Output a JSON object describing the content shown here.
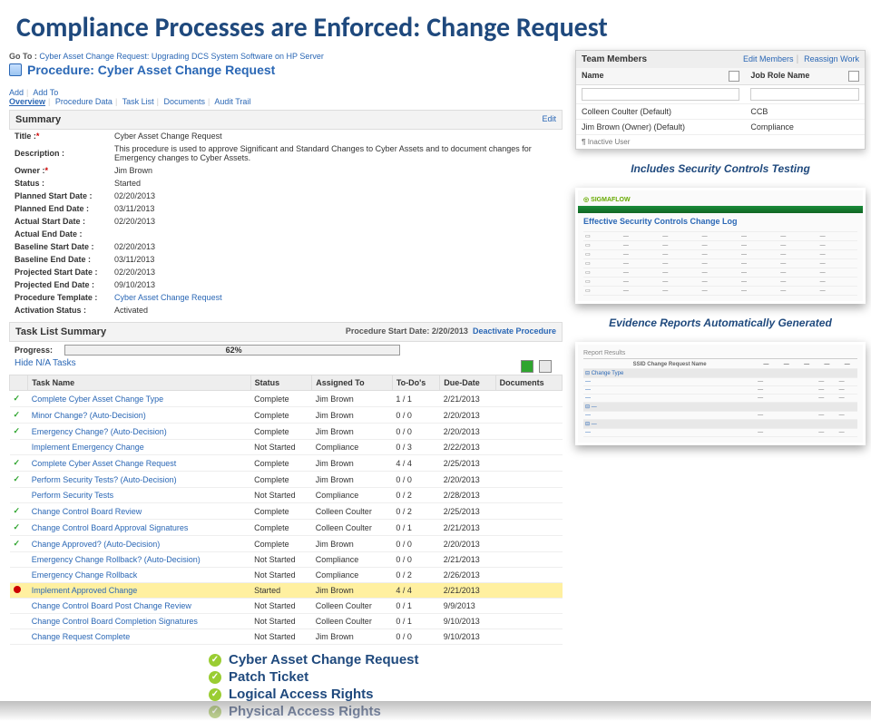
{
  "slide_title": "Compliance Processes are Enforced: Change Request",
  "goto": {
    "label": "Go To :",
    "link": "Cyber Asset Change Request: Upgrading DCS System Software on HP Server"
  },
  "procedure_title": "Procedure: Cyber Asset Change Request",
  "tabs": {
    "add": "Add",
    "add_to": "Add To",
    "overview": "Overview",
    "procedure_data": "Procedure Data",
    "task_list": "Task List",
    "documents": "Documents",
    "audit_trail": "Audit Trail"
  },
  "summary_header": "Summary",
  "edit_link": "Edit",
  "summary": [
    {
      "k": "Title :",
      "req": true,
      "v": "Cyber Asset Change Request"
    },
    {
      "k": "Description :",
      "v": "This procedure is used to approve Significant and Standard Changes to Cyber Assets and to document changes for Emergency changes to Cyber Assets."
    },
    {
      "k": "Owner :",
      "req": true,
      "v": "Jim Brown"
    },
    {
      "k": "Status :",
      "v": "Started"
    },
    {
      "k": "Planned Start Date :",
      "v": "02/20/2013"
    },
    {
      "k": "Planned End Date :",
      "v": "03/11/2013"
    },
    {
      "k": "Actual Start Date :",
      "v": "02/20/2013"
    },
    {
      "k": "Actual End Date :",
      "v": ""
    },
    {
      "k": "Baseline Start Date :",
      "v": "02/20/2013"
    },
    {
      "k": "Baseline End Date :",
      "v": "03/11/2013"
    },
    {
      "k": "Projected Start Date :",
      "v": "02/20/2013"
    },
    {
      "k": "Projected End Date :",
      "v": "09/10/2013"
    },
    {
      "k": "Procedure Template :",
      "v": "Cyber Asset Change Request",
      "link": true
    },
    {
      "k": "Activation Status :",
      "v": "Activated"
    }
  ],
  "task_list_header": "Task List Summary",
  "proc_start": {
    "label": "Procedure Start Date:",
    "value": "2/20/2013",
    "action": "Deactivate Procedure"
  },
  "progress": {
    "label": "Progress:",
    "pct": "62%",
    "pct_num": 62
  },
  "hide_na": "Hide N/A Tasks",
  "task_cols": [
    "",
    "Task Name",
    "Status",
    "Assigned To",
    "To-Do's",
    "Due-Date",
    "Documents"
  ],
  "tasks": [
    {
      "icon": "check",
      "name": "Complete Cyber Asset Change Type",
      "status": "Complete",
      "assigned": "Jim Brown",
      "todos": "1 / 1",
      "due": "2/21/2013"
    },
    {
      "icon": "check",
      "name": "Minor Change? (Auto-Decision)",
      "status": "Complete",
      "assigned": "Jim Brown",
      "todos": "0 / 0",
      "due": "2/20/2013"
    },
    {
      "icon": "check",
      "name": "Emergency Change? (Auto-Decision)",
      "status": "Complete",
      "assigned": "Jim Brown",
      "todos": "0 / 0",
      "due": "2/20/2013"
    },
    {
      "icon": "",
      "name": "Implement Emergency Change",
      "status": "Not Started",
      "assigned": "Compliance",
      "todos": "0 / 3",
      "due": "2/22/2013"
    },
    {
      "icon": "check",
      "name": "Complete Cyber Asset Change Request",
      "status": "Complete",
      "assigned": "Jim Brown",
      "todos": "4 / 4",
      "due": "2/25/2013"
    },
    {
      "icon": "check",
      "name": "Perform Security Tests? (Auto-Decision)",
      "status": "Complete",
      "assigned": "Jim Brown",
      "todos": "0 / 0",
      "due": "2/20/2013"
    },
    {
      "icon": "",
      "name": "Perform Security Tests",
      "status": "Not Started",
      "assigned": "Compliance",
      "todos": "0 / 2",
      "due": "2/28/2013"
    },
    {
      "icon": "check",
      "name": "Change Control Board Review",
      "status": "Complete",
      "assigned": "Colleen Coulter",
      "todos": "0 / 2",
      "due": "2/25/2013"
    },
    {
      "icon": "check",
      "name": "Change Control Board Approval Signatures",
      "status": "Complete",
      "assigned": "Colleen Coulter",
      "todos": "0 / 1",
      "due": "2/21/2013"
    },
    {
      "icon": "check",
      "name": "Change Approved? (Auto-Decision)",
      "status": "Complete",
      "assigned": "Jim Brown",
      "todos": "0 / 0",
      "due": "2/20/2013"
    },
    {
      "icon": "",
      "name": "Emergency Change Rollback? (Auto-Decision)",
      "status": "Not Started",
      "assigned": "Compliance",
      "todos": "0 / 0",
      "due": "2/21/2013"
    },
    {
      "icon": "",
      "name": "Emergency Change Rollback",
      "status": "Not Started",
      "assigned": "Compliance",
      "todos": "0 / 2",
      "due": "2/26/2013"
    },
    {
      "icon": "red",
      "name": "Implement Approved Change",
      "status": "Started",
      "assigned": "Jim Brown",
      "todos": "4 / 4",
      "due": "2/21/2013",
      "hl": true
    },
    {
      "icon": "",
      "name": "Change Control Board Post Change Review",
      "status": "Not Started",
      "assigned": "Colleen Coulter",
      "todos": "0 / 1",
      "due": "9/9/2013"
    },
    {
      "icon": "",
      "name": "Change Control Board Completion Signatures",
      "status": "Not Started",
      "assigned": "Colleen Coulter",
      "todos": "0 / 1",
      "due": "9/10/2013"
    },
    {
      "icon": "",
      "name": "Change Request Complete",
      "status": "Not Started",
      "assigned": "Jim Brown",
      "todos": "0 / 0",
      "due": "9/10/2013"
    }
  ],
  "team": {
    "header": "Team Members",
    "edit": "Edit Members",
    "reassign": "Reassign Work",
    "cols": [
      "Name",
      "Job Role Name"
    ],
    "rows": [
      {
        "name": "Colleen Coulter (Default)",
        "role": "CCB"
      },
      {
        "name": "Jim Brown (Owner) (Default)",
        "role": "Compliance"
      }
    ],
    "inactive": "Inactive User"
  },
  "callout1": "Includes Security Controls Testing",
  "sc_shot": {
    "logo": "SIGMAFLOW",
    "title": "Effective Security Controls Change Log"
  },
  "callout2": "Evidence Reports Automatically Generated",
  "ev_shot": {
    "hdr": "Report Results",
    "sub1": "SSID Change Request Name",
    "ct": "Change Type"
  },
  "bullets": [
    {
      "t": "Cyber Asset Change Request"
    },
    {
      "t": "Patch Ticket"
    },
    {
      "t": "Logical Access Rights"
    },
    {
      "t": "Physical Access Rights",
      "dim": true
    }
  ]
}
